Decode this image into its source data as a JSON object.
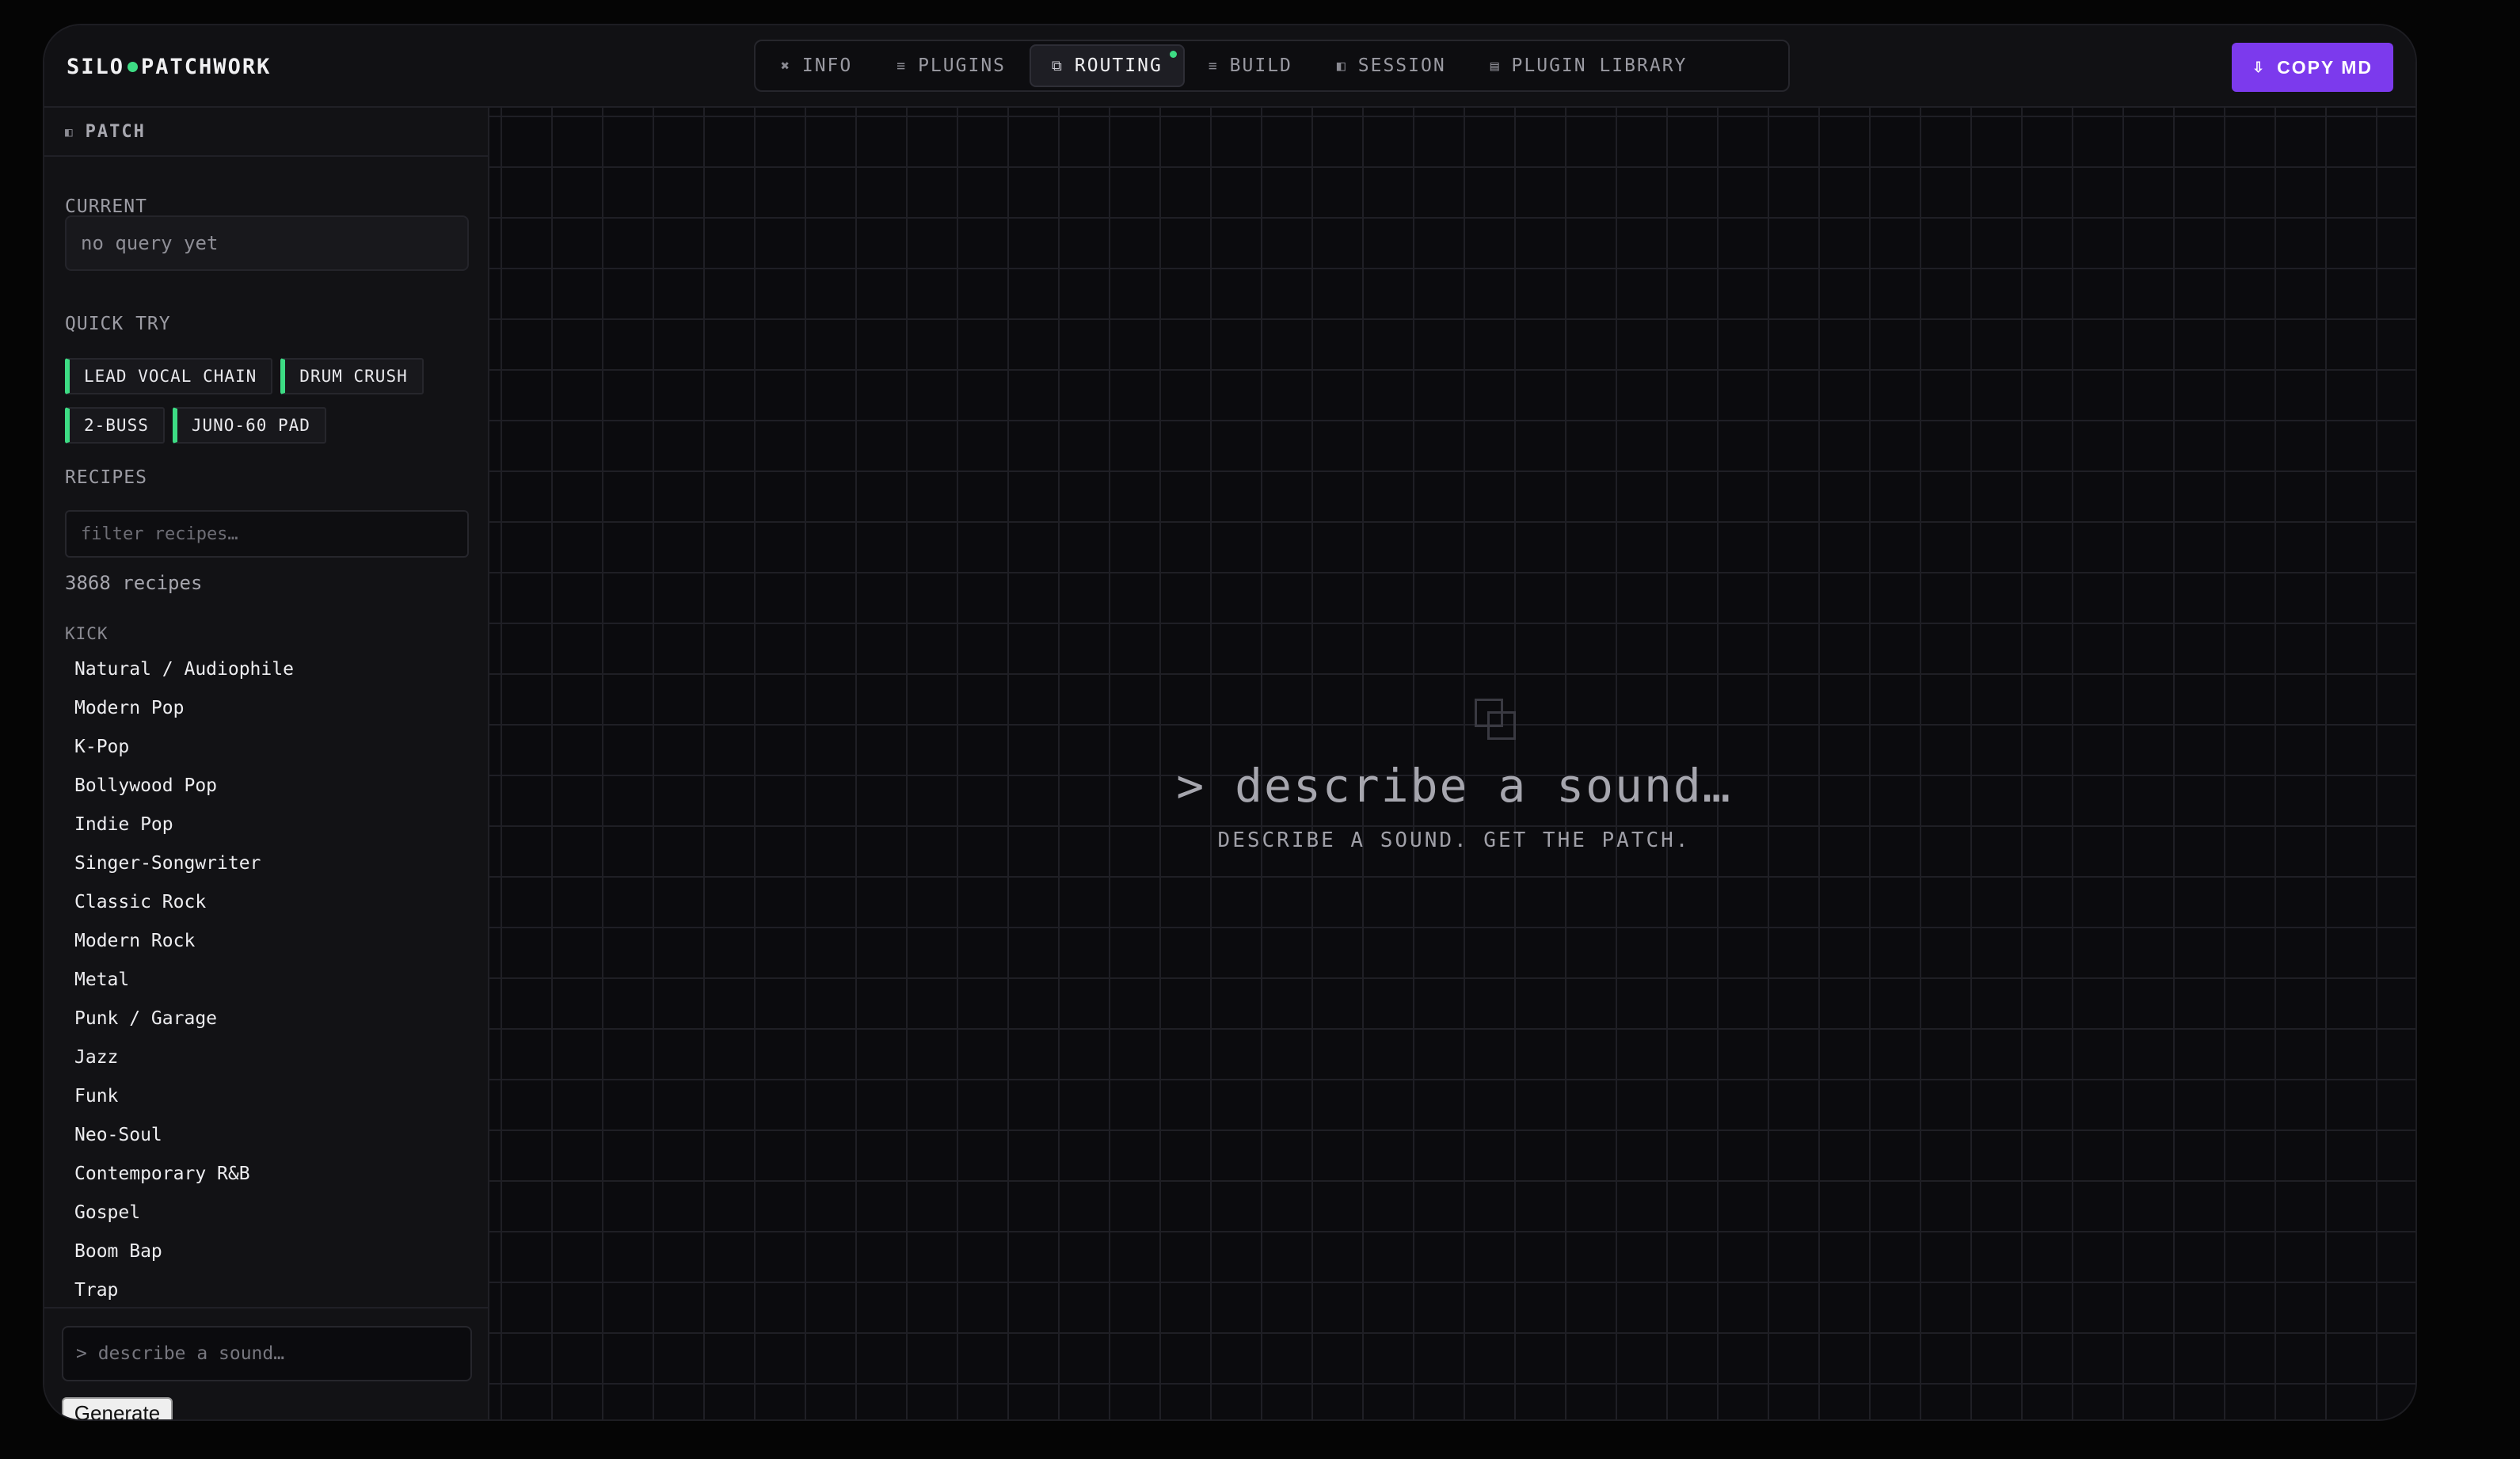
{
  "brand": {
    "left": "SILO",
    "right": "PATCHWORK"
  },
  "tabs": [
    {
      "label": "INFO",
      "icon": "✖",
      "icon_name": "info-icon"
    },
    {
      "label": "PLUGINS",
      "icon": "≡",
      "icon_name": "plugins-icon"
    },
    {
      "label": "ROUTING",
      "icon": "⧉",
      "icon_name": "routing-icon",
      "active": true
    },
    {
      "label": "BUILD",
      "icon": "≡",
      "icon_name": "build-icon"
    },
    {
      "label": "SESSION",
      "icon": "◧",
      "icon_name": "session-icon"
    },
    {
      "label": "PLUGIN LIBRARY",
      "icon": "▤",
      "icon_name": "library-icon"
    }
  ],
  "copy_button": {
    "label": "COPY MD",
    "icon": "⇩"
  },
  "sidebar": {
    "title": "PATCH",
    "current_label": "CURRENT",
    "current_value": "no query yet",
    "quick_try_label": "QUICK TRY",
    "quick_try": [
      "LEAD VOCAL CHAIN",
      "DRUM CRUSH",
      "2-BUSS",
      "JUNO-60 PAD"
    ],
    "recipes_label": "RECIPES",
    "filter_placeholder": "filter recipes…",
    "recipe_count": "3868 recipes",
    "group_label": "KICK",
    "recipes": [
      "Natural / Audiophile",
      "Modern Pop",
      "K-Pop",
      "Bollywood Pop",
      "Indie Pop",
      "Singer-Songwriter",
      "Classic Rock",
      "Modern Rock",
      "Metal",
      "Punk / Garage",
      "Jazz",
      "Funk",
      "Neo-Soul",
      "Contemporary R&B",
      "Gospel",
      "Boom Bap",
      "Trap"
    ],
    "prompt_placeholder": "> describe a sound…",
    "generate_label": "Generate"
  },
  "canvas": {
    "empty_title": "> describe a sound…",
    "empty_subtitle": "DESCRIBE A SOUND. GET THE PATCH."
  },
  "colors": {
    "accent": "#7c3aed",
    "live": "#3ddc84"
  }
}
